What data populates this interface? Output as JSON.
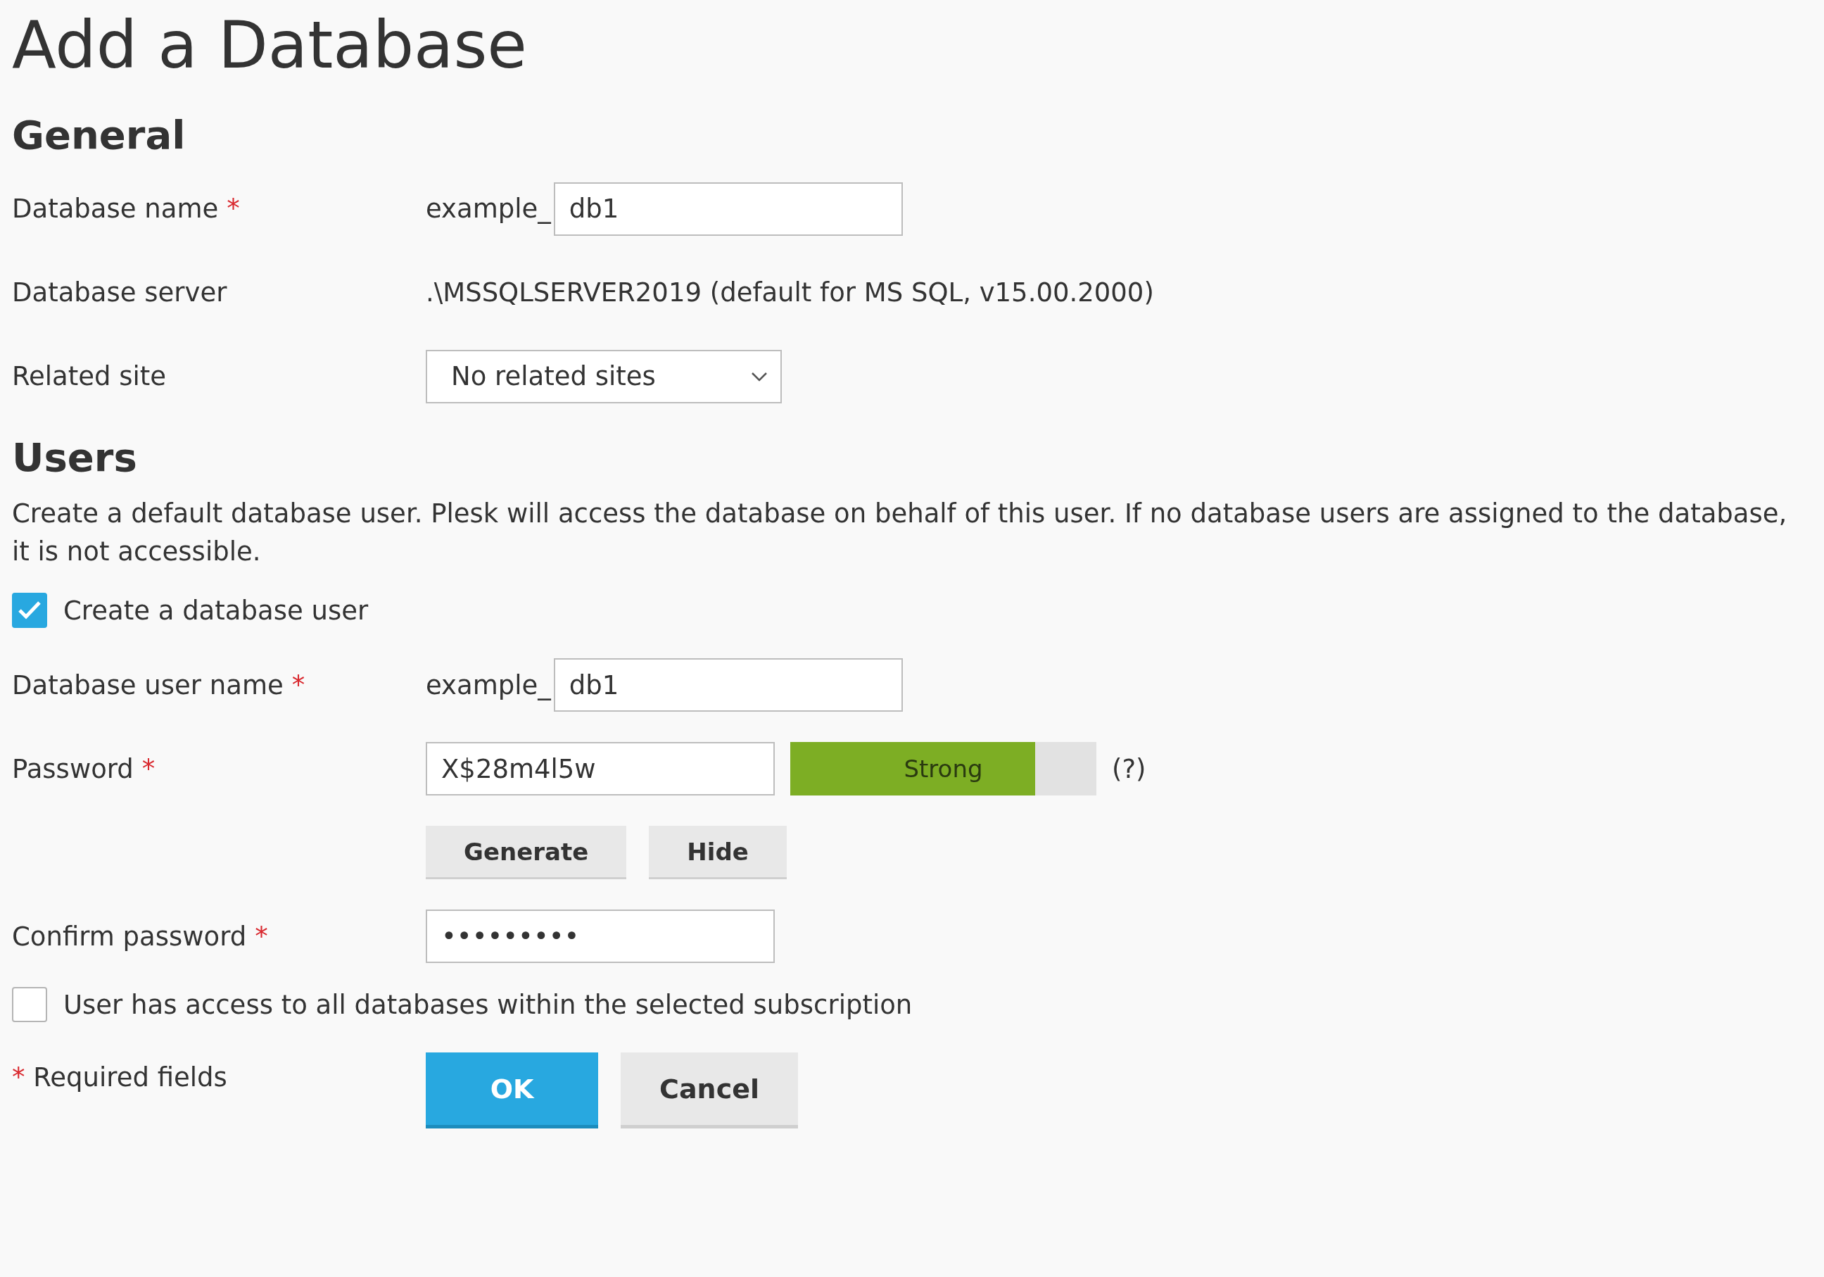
{
  "title": "Add a Database",
  "general": {
    "heading": "General",
    "fields": [
      {
        "kind": "prefixed-input",
        "label": "Database name",
        "required_mark": "*",
        "prefix": "example_",
        "value": "db1"
      },
      {
        "kind": "text",
        "label": "Database server",
        "value": ".\\MSSQLSERVER2019 (default for MS SQL, v15.00.2000)"
      },
      {
        "kind": "select",
        "label": "Related site",
        "value": "No related sites"
      }
    ]
  },
  "users": {
    "heading": "Users",
    "description": "Create a default database user. Plesk will access the database on behalf of this user. If no database users are assigned to the database, it is not accessible.",
    "create_user": {
      "label": "Create a database user",
      "checked": true
    },
    "fields": [
      {
        "kind": "prefixed-input",
        "label": "Database user name",
        "required_mark": "*",
        "prefix": "example_",
        "value": "db1"
      },
      {
        "kind": "password",
        "label": "Password",
        "required_mark": "*",
        "value": "X$28m4l5w",
        "strength": {
          "label": "Strong",
          "level": 0.8
        },
        "help": "(?)"
      },
      {
        "kind": "buttons",
        "buttons": [
          "Generate",
          "Hide"
        ]
      },
      {
        "kind": "input",
        "label": "Confirm password",
        "required_mark": "*",
        "value": "•••••••••"
      }
    ],
    "all_access": {
      "label": "User has access to all databases within the selected subscription",
      "checked": false
    }
  },
  "footer": {
    "required_mark": "*",
    "note": "Required fields",
    "buttons": [
      {
        "label": "OK",
        "kind": "primary"
      },
      {
        "label": "Cancel",
        "kind": "secondary"
      }
    ]
  }
}
